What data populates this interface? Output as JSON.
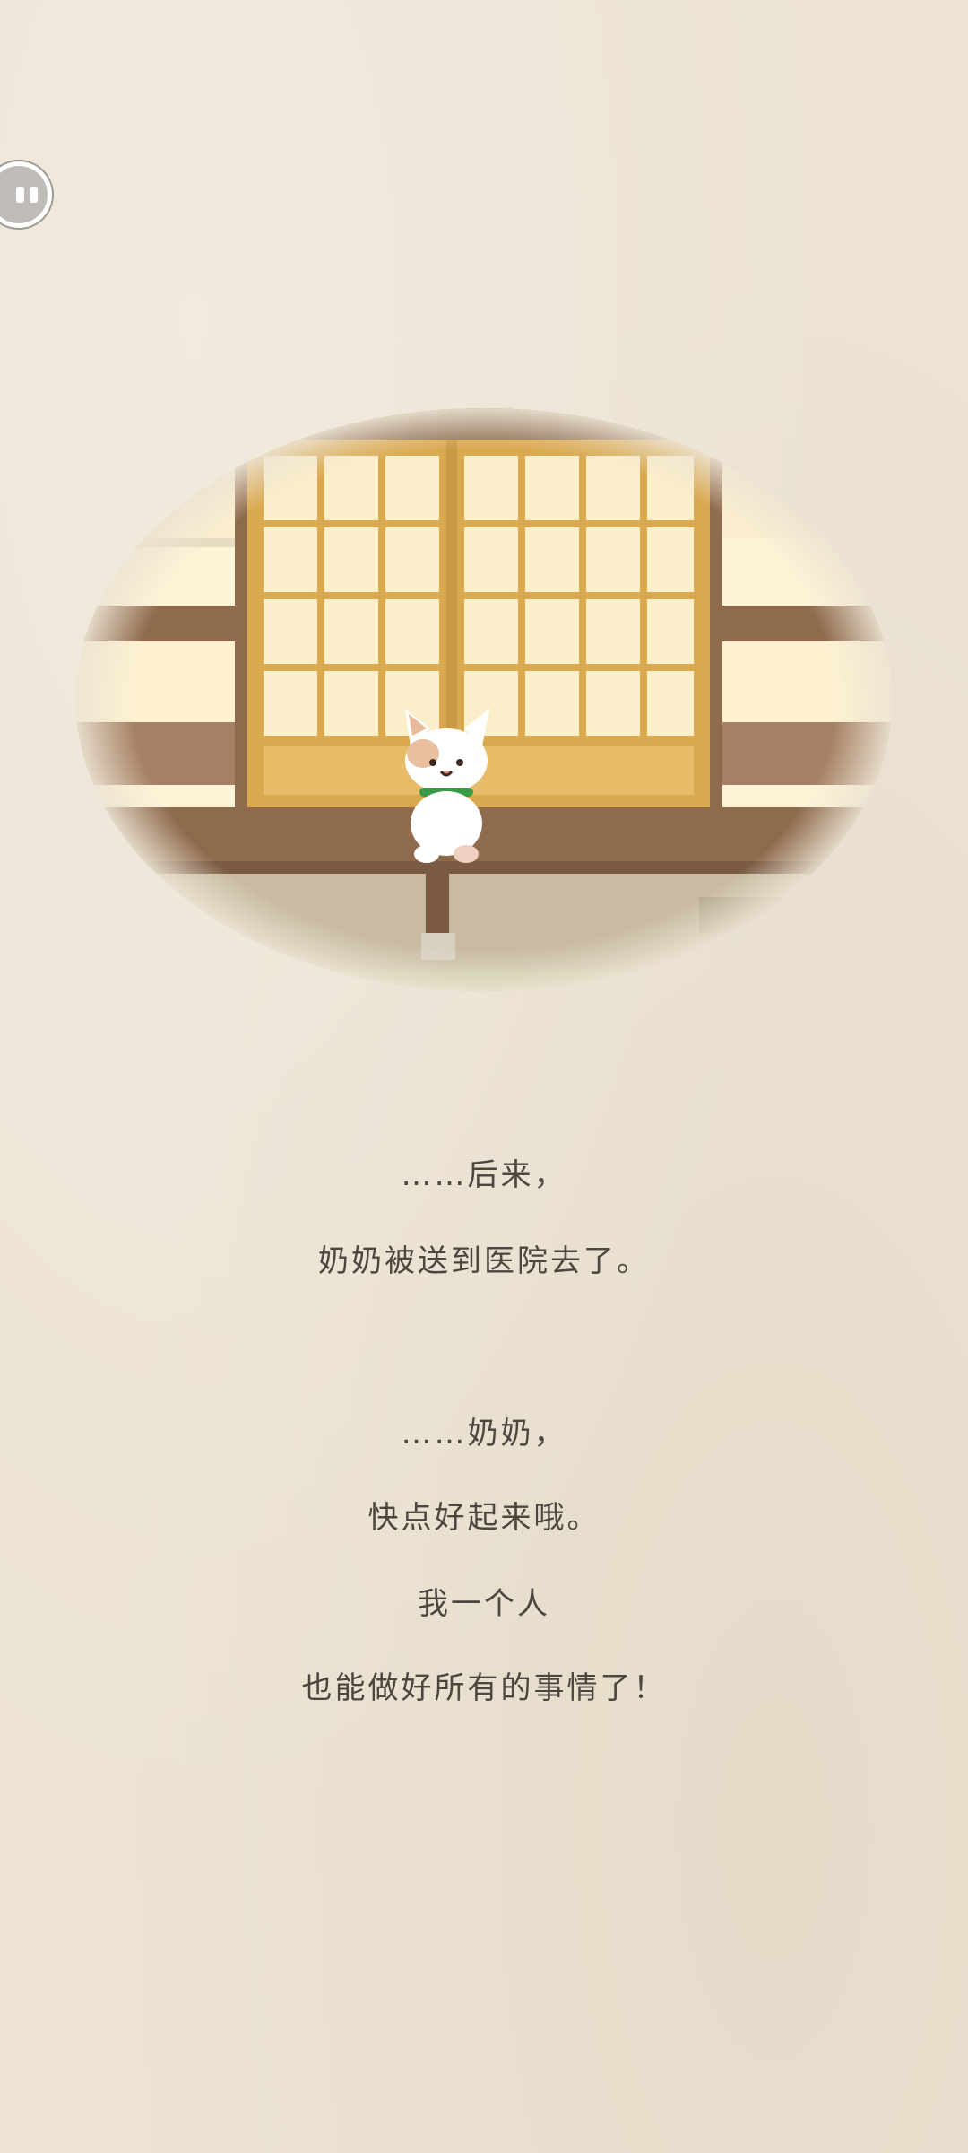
{
  "controls": {
    "pause_icon": "pause-icon"
  },
  "scene": {
    "description_icon": "cat-on-porch-illustration",
    "colors": {
      "wood": "#8f6b4e",
      "door_frame": "#d9a94f",
      "paper_panel": "#fbeecb",
      "wall": "#fdf3d6",
      "collar": "#3a9a45"
    }
  },
  "story": {
    "lines": [
      "……后来，",
      "奶奶被送到医院去了。",
      "……奶奶，",
      "快点好起来哦。",
      "我一个人",
      "也能做好所有的事情了！"
    ]
  }
}
